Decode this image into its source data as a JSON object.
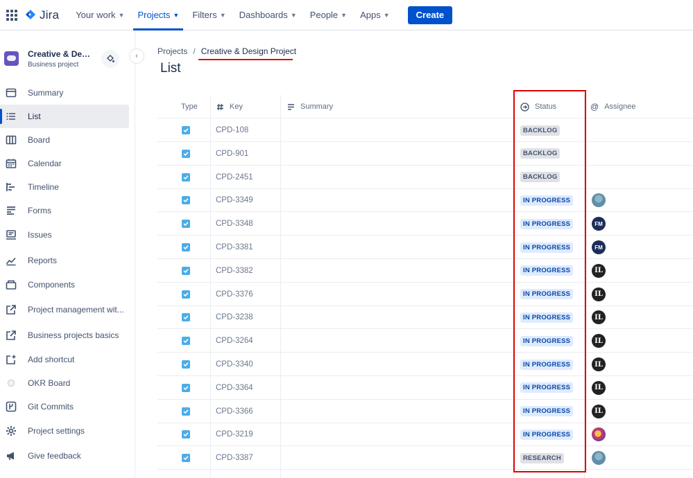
{
  "topnav": {
    "app_name": "Jira",
    "items": [
      {
        "label": "Your work",
        "active": false
      },
      {
        "label": "Projects",
        "active": true
      },
      {
        "label": "Filters",
        "active": false
      },
      {
        "label": "Dashboards",
        "active": false
      },
      {
        "label": "People",
        "active": false
      },
      {
        "label": "Apps",
        "active": false
      }
    ],
    "create_label": "Create",
    "colors": {
      "accent": "#0052cc"
    }
  },
  "sidebar": {
    "project_name": "Creative & Design Project",
    "project_type": "Business project",
    "items": [
      {
        "label": "Summary",
        "icon": "summary-icon"
      },
      {
        "label": "List",
        "icon": "list-icon",
        "active": true
      },
      {
        "label": "Board",
        "icon": "board-icon"
      },
      {
        "label": "Calendar",
        "icon": "calendar-icon"
      },
      {
        "label": "Timeline",
        "icon": "timeline-icon"
      },
      {
        "label": "Forms",
        "icon": "forms-icon"
      },
      {
        "label": "Issues",
        "icon": "issues-icon"
      },
      {
        "label": "Reports",
        "icon": "reports-icon"
      },
      {
        "label": "Components",
        "icon": "components-icon"
      },
      {
        "label": "Project management wit...",
        "icon": "external-link-icon"
      },
      {
        "label": "Business projects basics",
        "icon": "external-link-icon"
      },
      {
        "label": "Add shortcut",
        "icon": "add-shortcut-icon"
      },
      {
        "label": "OKR Board",
        "icon": "okr-icon"
      },
      {
        "label": "Git Commits",
        "icon": "git-icon"
      },
      {
        "label": "Project settings",
        "icon": "gear-icon"
      },
      {
        "label": "Give feedback",
        "icon": "megaphone-icon"
      }
    ]
  },
  "breadcrumb": {
    "root": "Projects",
    "separator": "/",
    "current": "Creative & Design Project"
  },
  "page_title": "List",
  "table": {
    "columns": {
      "type": "Type",
      "key": "Key",
      "summary": "Summary",
      "status": "Status",
      "assignee": "Assignee"
    },
    "rows": [
      {
        "key": "CPD-108",
        "status": "BACKLOG",
        "assignee": ""
      },
      {
        "key": "CPD-901",
        "status": "BACKLOG",
        "assignee": ""
      },
      {
        "key": "CPD-2451",
        "status": "BACKLOG",
        "assignee": ""
      },
      {
        "key": "CPD-3349",
        "status": "IN PROGRESS",
        "assignee": "photo"
      },
      {
        "key": "CPD-3348",
        "status": "IN PROGRESS",
        "assignee": "FM"
      },
      {
        "key": "CPD-3381",
        "status": "IN PROGRESS",
        "assignee": "FM"
      },
      {
        "key": "CPD-3382",
        "status": "IN PROGRESS",
        "assignee": "IL"
      },
      {
        "key": "CPD-3376",
        "status": "IN PROGRESS",
        "assignee": "IL"
      },
      {
        "key": "CPD-3238",
        "status": "IN PROGRESS",
        "assignee": "IL"
      },
      {
        "key": "CPD-3264",
        "status": "IN PROGRESS",
        "assignee": "IL"
      },
      {
        "key": "CPD-3340",
        "status": "IN PROGRESS",
        "assignee": "IL"
      },
      {
        "key": "CPD-3364",
        "status": "IN PROGRESS",
        "assignee": "IL"
      },
      {
        "key": "CPD-3366",
        "status": "IN PROGRESS",
        "assignee": "IL"
      },
      {
        "key": "CPD-3219",
        "status": "IN PROGRESS",
        "assignee": "photo2"
      },
      {
        "key": "CPD-3387",
        "status": "RESEARCH",
        "assignee": "photo"
      }
    ]
  }
}
